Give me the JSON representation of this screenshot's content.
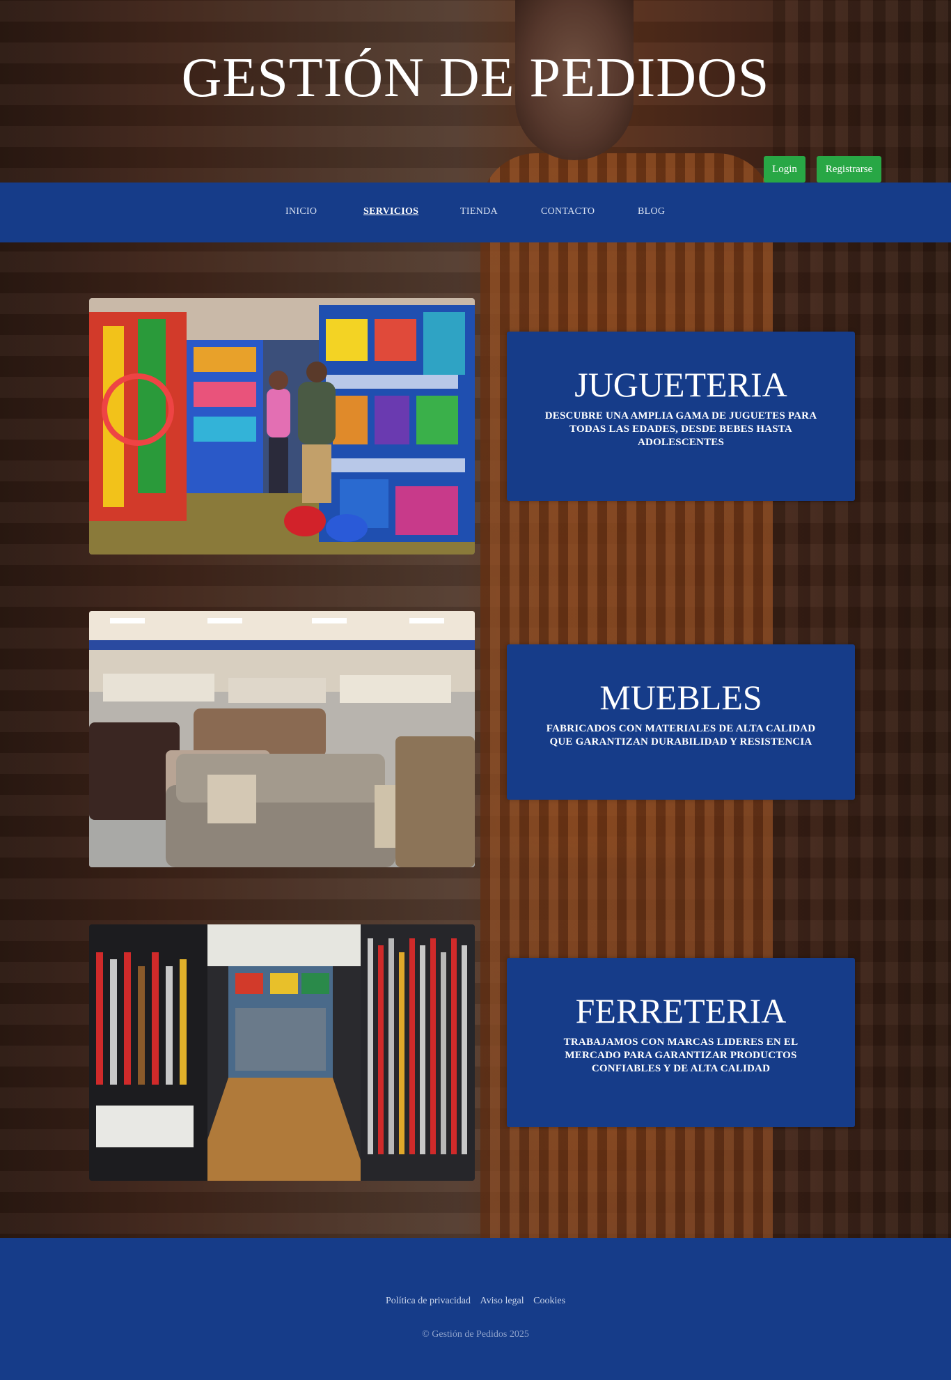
{
  "header": {
    "site_title": "GESTIÓN DE PEDIDOS",
    "login_label": "Login",
    "register_label": "Registrarse"
  },
  "nav": {
    "items": [
      {
        "label": "INICIO"
      },
      {
        "label": "SERVICIOS",
        "active": true
      },
      {
        "label": "TIENDA"
      },
      {
        "label": "CONTACTO"
      },
      {
        "label": "BLOG"
      }
    ]
  },
  "services": [
    {
      "title": "JUGUETERIA",
      "description": "DESCUBRE UNA AMPLIA GAMA DE JUGUETES PARA TODAS LAS EDADES, DESDE BEBES HASTA ADOLESCENTES",
      "image": "toy-store-photo"
    },
    {
      "title": "MUEBLES",
      "description": "FABRICADOS CON MATERIALES DE ALTA CALIDAD QUE GARANTIZAN DURABILIDAD Y RESISTENCIA",
      "image": "furniture-showroom-photo"
    },
    {
      "title": "FERRETERIA",
      "description": "TRABAJAMOS CON MARCAS LIDERES EN EL MERCADO PARA GARANTIZAR PRODUCTOS CONFIABLES Y DE ALTA CALIDAD",
      "image": "hardware-store-photo"
    }
  ],
  "footer": {
    "links": [
      "Política de privacidad",
      "Aviso legal",
      "Cookies"
    ],
    "copyright": "© Gestión de Pedidos 2025"
  },
  "colors": {
    "primary_blue": "#163c89",
    "button_green": "#28a745"
  }
}
